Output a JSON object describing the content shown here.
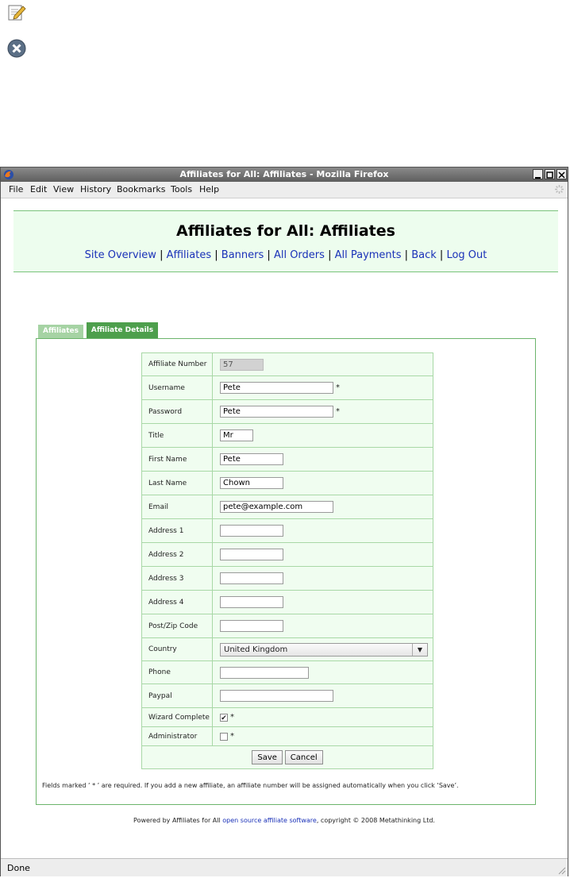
{
  "window": {
    "title": "Affiliates for All: Affiliates - Mozilla Firefox",
    "menu": [
      "File",
      "Edit",
      "View",
      "History",
      "Bookmarks",
      "Tools",
      "Help"
    ],
    "status": "Done"
  },
  "header": {
    "title": "Affiliates for All: Affiliates",
    "nav": [
      "Site Overview",
      "Affiliates",
      "Banners",
      "All Orders",
      "All Payments",
      "Back",
      "Log Out"
    ],
    "separator": "|"
  },
  "tabs": [
    "Affiliates",
    "Affiliate Details"
  ],
  "form": {
    "affiliate_number": {
      "label": "Affiliate Number",
      "value": "57"
    },
    "username": {
      "label": "Username",
      "value": "Pete"
    },
    "password": {
      "label": "Password",
      "value": "Pete"
    },
    "title": {
      "label": "Title",
      "value": "Mr"
    },
    "first_name": {
      "label": "First Name",
      "value": "Pete"
    },
    "last_name": {
      "label": "Last Name",
      "value": "Chown"
    },
    "email": {
      "label": "Email",
      "value": "pete@example.com"
    },
    "address1": {
      "label": "Address 1",
      "value": ""
    },
    "address2": {
      "label": "Address 2",
      "value": ""
    },
    "address3": {
      "label": "Address 3",
      "value": ""
    },
    "address4": {
      "label": "Address 4",
      "value": ""
    },
    "postcode": {
      "label": "Post/Zip Code",
      "value": ""
    },
    "country": {
      "label": "Country",
      "value": "United Kingdom"
    },
    "phone": {
      "label": "Phone",
      "value": ""
    },
    "paypal": {
      "label": "Paypal",
      "value": ""
    },
    "wizard_complete": {
      "label": "Wizard Complete",
      "checked": true
    },
    "administrator": {
      "label": "Administrator",
      "checked": false
    },
    "required_mark": "*",
    "save_label": "Save",
    "cancel_label": "Cancel"
  },
  "notes": {
    "required": "Fields marked ‘ * ’ are required. If you add a new affiliate, an affiliate number will be assigned automatically when you click ‘Save’."
  },
  "footer": {
    "prefix": "Powered by Affiliates for All ",
    "link": "open source affiliate software",
    "suffix": ", copyright © 2008 Metathinking Ltd."
  },
  "colors": {
    "accent": "#4d9f4c",
    "panel_bg": "#edfdee",
    "link": "#1a31b8"
  }
}
